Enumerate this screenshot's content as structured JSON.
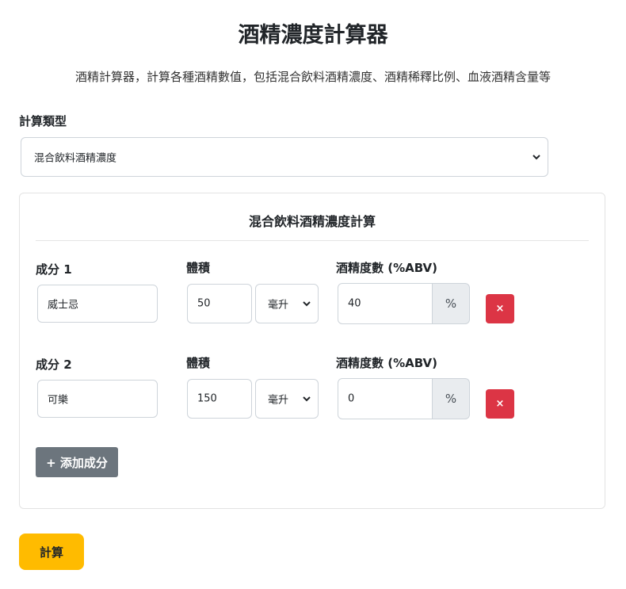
{
  "header": {
    "title": "酒精濃度計算器",
    "subtitle": "酒精計算器，計算各種酒精數值，包括混合飲料酒精濃度、酒精稀釋比例、血液酒精含量等"
  },
  "calc_type": {
    "label": "計算類型",
    "selected": "混合飲料酒精濃度"
  },
  "card": {
    "title": "混合飲料酒精濃度計算",
    "volume_label": "體積",
    "abv_label": "酒精度數 (%ABV)",
    "percent_addon": "%",
    "remove_label": "×",
    "ingredients": [
      {
        "label": "成分 1",
        "name": "威士忌",
        "volume": "50",
        "unit": "毫升",
        "abv": "40"
      },
      {
        "label": "成分 2",
        "name": "可樂",
        "volume": "150",
        "unit": "毫升",
        "abv": "0"
      }
    ],
    "add_button": "+ 添加成分"
  },
  "calculate_button": "計算",
  "icons": {
    "select_arrow": "chevron-down-icon",
    "remove": "close-icon"
  },
  "colors": {
    "danger": "#dc3545",
    "secondary": "#6c757d",
    "accent": "#ffbb00"
  }
}
